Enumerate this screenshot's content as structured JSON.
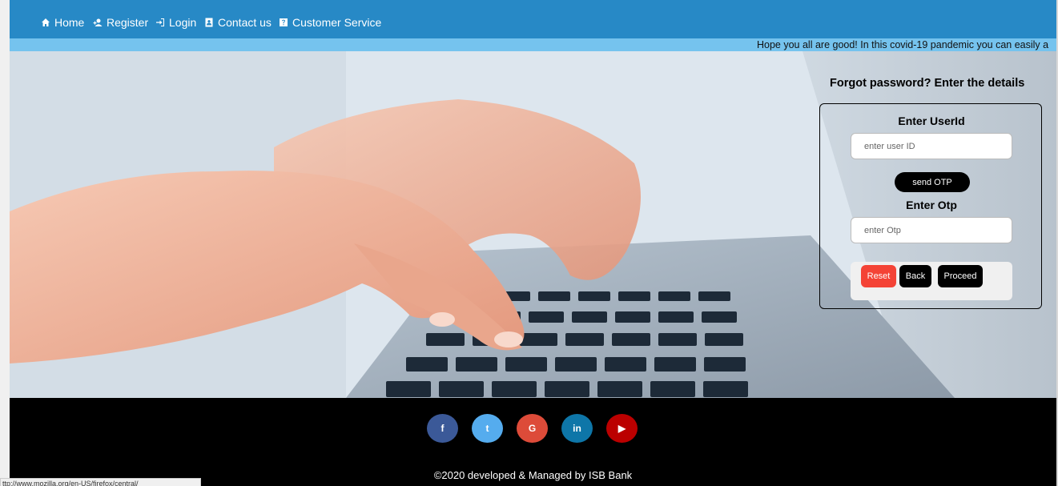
{
  "nav": {
    "items": [
      {
        "label": "Home",
        "icon": "home-icon"
      },
      {
        "label": "Register",
        "icon": "user-add-icon"
      },
      {
        "label": "Login",
        "icon": "login-icon"
      },
      {
        "label": "Contact us",
        "icon": "contact-icon"
      },
      {
        "label": "Customer Service",
        "icon": "help-icon"
      }
    ]
  },
  "marquee": {
    "text": "Hope you all are good! In this covid-19 pandemic you can easily a"
  },
  "form": {
    "title": "Forgot password? Enter the details",
    "userid_label": "Enter UserId",
    "userid_placeholder": "enter user ID",
    "send_otp_label": "send OTP",
    "otp_label": "Enter Otp",
    "otp_placeholder": "enter Otp",
    "reset_label": "Reset",
    "back_label": "Back",
    "proceed_label": "Proceed"
  },
  "footer": {
    "social": [
      {
        "glyph": "f",
        "icon": "facebook-icon",
        "color": "#3b5998"
      },
      {
        "glyph": "t",
        "icon": "twitter-icon",
        "color": "#55acee"
      },
      {
        "glyph": "G",
        "icon": "google-icon",
        "color": "#dd4b39"
      },
      {
        "glyph": "in",
        "icon": "linkedin-icon",
        "color": "#0e76a8"
      },
      {
        "glyph": "▶",
        "icon": "youtube-icon",
        "color": "#bb0000"
      }
    ],
    "copyright": "©2020 developed & Managed by ISB Bank"
  },
  "status_bar": {
    "text": "ttp://www.mozilla.org/en-US/firefox/central/"
  },
  "colors": {
    "navbar": "#2789c6",
    "marquee_bg": "#75c3ee",
    "reset": "#f44336",
    "dark_button": "#000000"
  }
}
